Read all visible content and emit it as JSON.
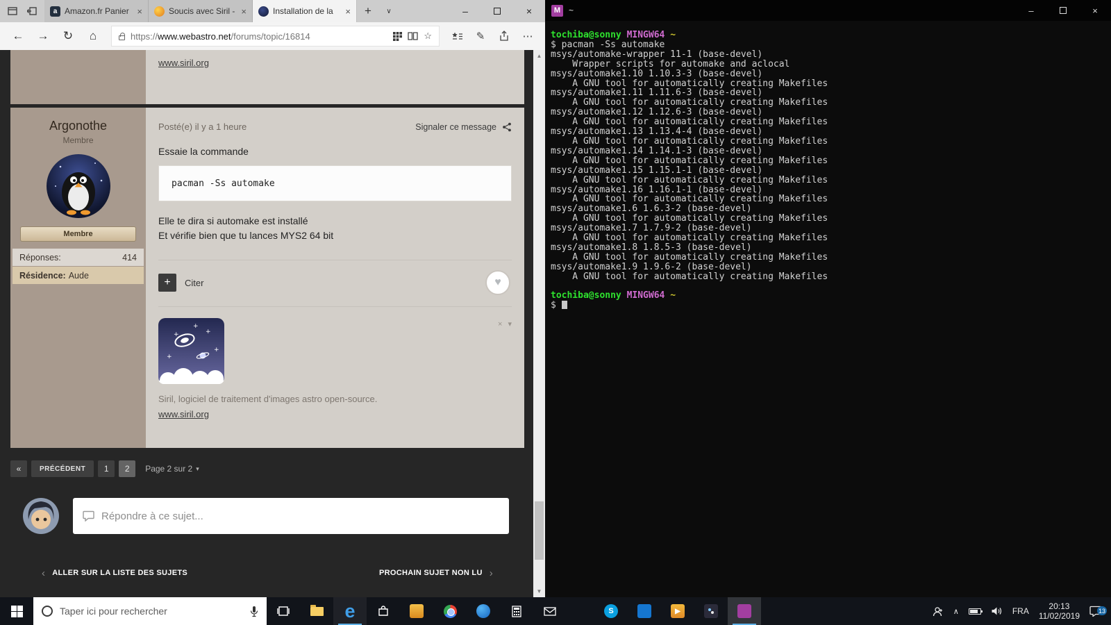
{
  "colors": {
    "accent_blue": "#5fb2e8",
    "msys_magenta": "#a23ea0",
    "terminal_green": "#2ee22e",
    "terminal_purple": "#cf6bcf",
    "forum_taupe": "#a89a8e",
    "forum_beige": "#d9c9ab"
  },
  "glyphs": {
    "new_tab": "+",
    "tab_chevron": "∨",
    "back": "←",
    "forward": "→",
    "refresh": "↻",
    "home": "⌂",
    "star": "☆",
    "pen": "✎",
    "more": "⋯",
    "minimize": "–",
    "close": "×",
    "caret_down": "▾",
    "first_page": "«",
    "chev_left": "‹",
    "chev_right": "›",
    "heart": "♥",
    "plus": "+",
    "tray_up": "∧",
    "play": "▶",
    "amazon": "a",
    "edge": "e",
    "skype": "S",
    "scroll_up": "▲",
    "scroll_down": "▼",
    "card_close": "×"
  },
  "browser": {
    "tabs": [
      {
        "label": "Amazon.fr Panier"
      },
      {
        "label": "Soucis avec Siril - As"
      },
      {
        "label": "Installation de la"
      }
    ],
    "url": {
      "scheme": "https://",
      "host": "www.webastro.net",
      "path": "/forums/topic/16814"
    },
    "page": {
      "prev_post_link": "www.siril.org",
      "post": {
        "author": "Argonothe",
        "author_role": "Membre",
        "badge": "Membre",
        "stats": [
          {
            "label": "Réponses:",
            "value": "414"
          },
          {
            "label": "Résidence:",
            "value": "Aude"
          }
        ],
        "meta": "Posté(e) il y a 1 heure",
        "report": "Signaler ce message",
        "intro": "Essaie la commande",
        "code": "pacman -Ss automake",
        "line1": "Elle te dira si automake est installé",
        "line2": "Et vérifie bien que tu lances MYS2 64 bit",
        "quote": "Citer",
        "card_caption": "Siril, logiciel de traitement d'images astro open-source.",
        "card_link": "www.siril.org"
      },
      "pagination": {
        "prev": "PRÉCÉDENT",
        "page1": "1",
        "page2": "2",
        "label": "Page 2 sur 2"
      },
      "reply_placeholder": "Répondre à ce sujet...",
      "footer_left": "ALLER SUR LA LISTE DES SUJETS",
      "footer_right": "PROCHAIN SUJET NON LU"
    }
  },
  "terminal": {
    "title": "~",
    "icon": "M",
    "prompt_user": "tochiba@sonny",
    "prompt_env": "MINGW64",
    "prompt_path": "~",
    "command": "pacman -Ss automake",
    "packages": [
      {
        "name": "msys/automake-wrapper",
        "version": "11-1",
        "group": "(base-devel)",
        "desc": "Wrapper scripts for automake and aclocal"
      },
      {
        "name": "msys/automake1.10",
        "version": "1.10.3-3",
        "group": "(base-devel)",
        "desc": "A GNU tool for automatically creating Makefiles"
      },
      {
        "name": "msys/automake1.11",
        "version": "1.11.6-3",
        "group": "(base-devel)",
        "desc": "A GNU tool for automatically creating Makefiles"
      },
      {
        "name": "msys/automake1.12",
        "version": "1.12.6-3",
        "group": "(base-devel)",
        "desc": "A GNU tool for automatically creating Makefiles"
      },
      {
        "name": "msys/automake1.13",
        "version": "1.13.4-4",
        "group": "(base-devel)",
        "desc": "A GNU tool for automatically creating Makefiles"
      },
      {
        "name": "msys/automake1.14",
        "version": "1.14.1-3",
        "group": "(base-devel)",
        "desc": "A GNU tool for automatically creating Makefiles"
      },
      {
        "name": "msys/automake1.15",
        "version": "1.15.1-1",
        "group": "(base-devel)",
        "desc": "A GNU tool for automatically creating Makefiles"
      },
      {
        "name": "msys/automake1.16",
        "version": "1.16.1-1",
        "group": "(base-devel)",
        "desc": "A GNU tool for automatically creating Makefiles"
      },
      {
        "name": "msys/automake1.6",
        "version": "1.6.3-2",
        "group": "(base-devel)",
        "desc": "A GNU tool for automatically creating Makefiles"
      },
      {
        "name": "msys/automake1.7",
        "version": "1.7.9-2",
        "group": "(base-devel)",
        "desc": "A GNU tool for automatically creating Makefiles"
      },
      {
        "name": "msys/automake1.8",
        "version": "1.8.5-3",
        "group": "(base-devel)",
        "desc": "A GNU tool for automatically creating Makefiles"
      },
      {
        "name": "msys/automake1.9",
        "version": "1.9.6-2",
        "group": "(base-devel)",
        "desc": "A GNU tool for automatically creating Makefiles"
      }
    ]
  },
  "taskbar": {
    "search_placeholder": "Taper ici pour rechercher",
    "language": "FRA",
    "time": "20:13",
    "date": "11/02/2019",
    "badge": "13"
  }
}
